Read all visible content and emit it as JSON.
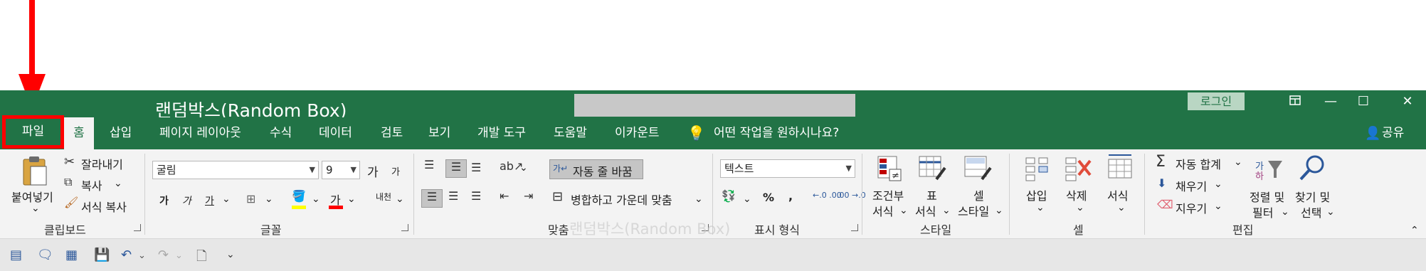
{
  "window": {
    "doc_title": "랜덤박스(Random Box)",
    "login_label": "로그인",
    "ribbon_display_icon": "ribbon-display-icon",
    "minimize": "—",
    "maximize": "☐",
    "close": "✕"
  },
  "tabs": {
    "file": "파일",
    "home": "홈",
    "insert": "삽입",
    "page_layout": "페이지 레이아웃",
    "formulas": "수식",
    "data": "데이터",
    "review": "검토",
    "view": "보기",
    "developer": "개발 도구",
    "help": "도움말",
    "account": "이카운트",
    "tell_me": "어떤 작업을 원하시나요?",
    "share": "공유"
  },
  "clipboard": {
    "paste": "붙여넣기",
    "cut": "잘라내기",
    "copy": "복사",
    "format_painter": "서식 복사",
    "group": "클립보드"
  },
  "font": {
    "name": "굴림",
    "size": "9",
    "grow": "가",
    "shrink": "가",
    "bold": "가",
    "italic": "가",
    "underline": "가",
    "color_letter": "가",
    "phonetic": "내천",
    "group": "글꼴"
  },
  "alignment": {
    "wrap_text": "자동 줄 바꿈",
    "merge_center": "병합하고 가운데 맞춤",
    "group": "맞춤"
  },
  "number": {
    "format": "텍스트",
    "percent": "%",
    "comma": ",",
    "inc_decimal": "←.0 .00",
    "dec_decimal": ".00 →.0",
    "group": "표시 형식"
  },
  "styles": {
    "conditional": "조건부",
    "conditional2": "서식",
    "table": "표",
    "table2": "서식",
    "cell": "셀",
    "cell2": "스타일",
    "group": "스타일"
  },
  "cells": {
    "insert": "삽입",
    "delete": "삭제",
    "format": "서식",
    "group": "셀"
  },
  "editing": {
    "autosum": "자동 합계",
    "fill": "채우기",
    "clear": "지우기",
    "sort": "정렬 및",
    "sort2": "필터",
    "find": "찾기 및",
    "find2": "선택",
    "group": "편집"
  },
  "watermark": "랜덤박스(Random Box)",
  "colors": {
    "excel_green": "#217346",
    "ribbon_bg": "#f3f3f3",
    "annotation_red": "#ff0000"
  }
}
